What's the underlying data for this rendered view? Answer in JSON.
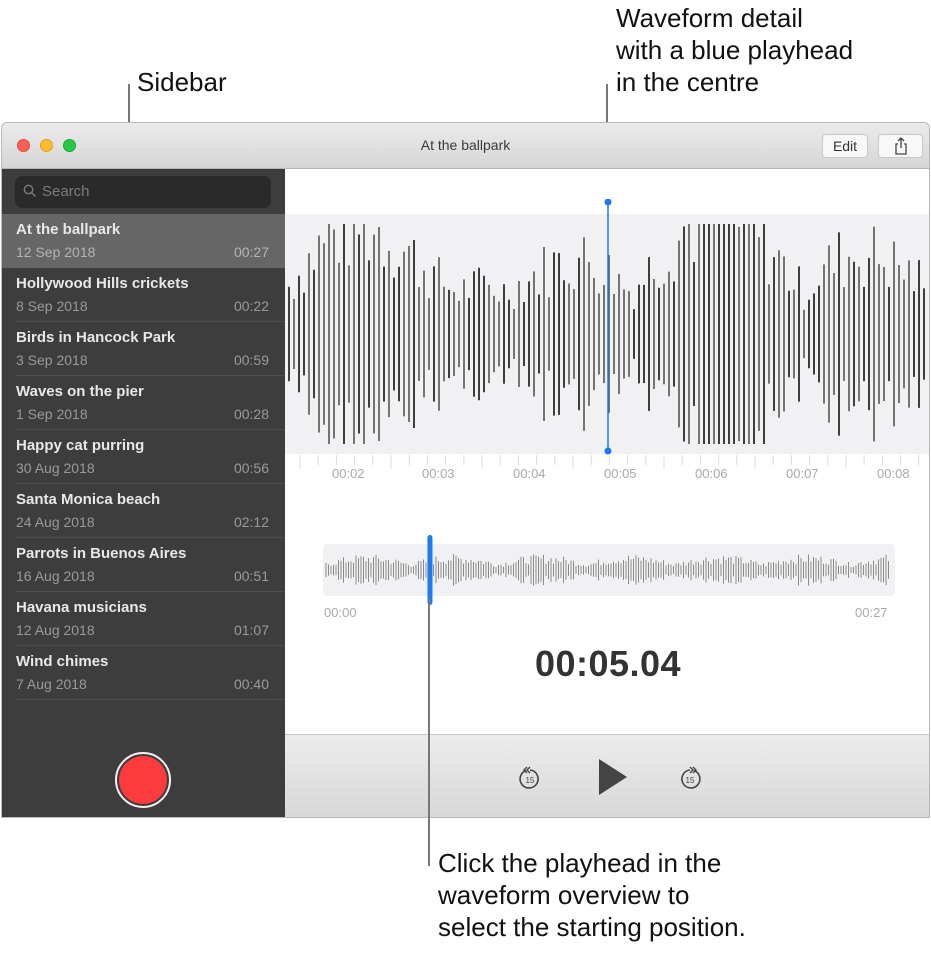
{
  "callouts": {
    "sidebar": "Sidebar",
    "waveform_detail": [
      "Waveform detail",
      "with a blue playhead",
      "in the centre"
    ],
    "overview": [
      "Click the playhead in the",
      "waveform overview to",
      "select the starting position."
    ]
  },
  "window": {
    "title": "At the ballpark",
    "edit_label": "Edit",
    "share_icon": "share-icon"
  },
  "sidebar": {
    "search_placeholder": "Search",
    "recordings": [
      {
        "title": "At the ballpark",
        "date": "12 Sep 2018",
        "duration": "00:27",
        "selected": true
      },
      {
        "title": "Hollywood Hills crickets",
        "date": "8 Sep 2018",
        "duration": "00:22"
      },
      {
        "title": "Birds in Hancock Park",
        "date": "3 Sep 2018",
        "duration": "00:59"
      },
      {
        "title": "Waves on the pier",
        "date": "1 Sep 2018",
        "duration": "00:28"
      },
      {
        "title": "Happy cat purring",
        "date": "30 Aug 2018",
        "duration": "00:56"
      },
      {
        "title": "Santa Monica beach",
        "date": "24 Aug 2018",
        "duration": "02:12"
      },
      {
        "title": "Parrots in Buenos Aires",
        "date": "16 Aug 2018",
        "duration": "00:51"
      },
      {
        "title": "Havana musicians",
        "date": "12 Aug 2018",
        "duration": "01:07"
      },
      {
        "title": "Wind chimes",
        "date": "7 Aug 2018",
        "duration": "00:40"
      }
    ],
    "record_button": "record-icon"
  },
  "player": {
    "detail_ticks": [
      "00:02",
      "00:03",
      "00:04",
      "00:05",
      "00:06",
      "00:07",
      "00:08"
    ],
    "overview_start": "00:00",
    "overview_end": "00:27",
    "current_time": "00:05.04",
    "playhead_fraction": 0.187,
    "skip_back_label": "15",
    "skip_forward_label": "15",
    "colors": {
      "playhead": "#1a7cf5",
      "record": "#fc3c3c"
    }
  }
}
